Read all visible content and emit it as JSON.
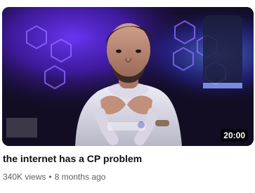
{
  "video": {
    "title": "the internet has a CP problem",
    "duration": "20:00",
    "views": "340K views",
    "separator": "•",
    "age": "8 months ago"
  },
  "colors": {
    "title": "#0f0f0f",
    "meta": "#606060",
    "duration_bg": "#000000",
    "thumbnail_purple": "#6a2cff",
    "thumbnail_blue": "#3d6dff"
  },
  "thumbnail": {
    "content": "person-in-hoodie-with-neon-hexagon-lights"
  }
}
